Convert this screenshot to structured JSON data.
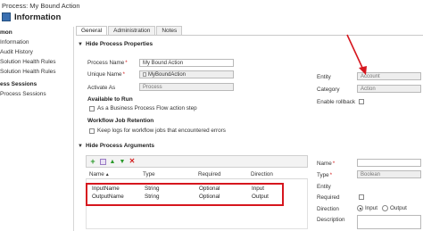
{
  "window": {
    "title": "Process: My Bound Action",
    "heading": "Information"
  },
  "sidebar": {
    "items": [
      {
        "label": "mon",
        "head": true
      },
      {
        "label": "Information",
        "head": false
      },
      {
        "label": "Audit History",
        "head": false
      },
      {
        "label": "Solution Health Rules",
        "head": false
      },
      {
        "label": "Solution Health Rules",
        "head": false
      },
      {
        "label": "ess Sessions",
        "head": true
      },
      {
        "label": "Process Sessions",
        "head": false
      }
    ]
  },
  "tabs": [
    {
      "label": "General",
      "active": true
    },
    {
      "label": "Administration",
      "active": false
    },
    {
      "label": "Notes",
      "active": false
    }
  ],
  "properties": {
    "section_label": "Hide Process Properties",
    "process_name_label": "Process Name",
    "process_name_value": "My Bound Action",
    "unique_name_label": "Unique Name",
    "unique_name_value": "MyBoundAction",
    "activate_as_label": "Activate As",
    "activate_as_value": "Process",
    "available_to_run_label": "Available to Run",
    "bpf_step_label": "As a Business Process Flow action step",
    "retention_label": "Workflow Job Retention",
    "keep_logs_label": "Keep logs for workflow jobs that encountered errors"
  },
  "right_props": {
    "entity_label": "Entity",
    "entity_value": "Account",
    "category_label": "Category",
    "category_value": "Action",
    "rollback_label": "Enable rollback"
  },
  "arguments": {
    "section_label": "Hide Process Arguments",
    "columns": [
      "Name",
      "Type",
      "Required",
      "Direction"
    ],
    "rows": [
      {
        "name": "InputName",
        "type": "String",
        "required": "Optional",
        "direction": "Input"
      },
      {
        "name": "OutputName",
        "type": "String",
        "required": "Optional",
        "direction": "Output"
      }
    ]
  },
  "arg_detail": {
    "name_label": "Name",
    "name_value": "",
    "type_label": "Type",
    "type_value": "Boolean",
    "entity_label": "Entity",
    "required_label": "Required",
    "direction_label": "Direction",
    "direction_input": "Input",
    "direction_output": "Output",
    "description_label": "Description"
  },
  "colors": {
    "annotation_red": "#d6161e",
    "required_star": "#d42222"
  },
  "icons": [
    "add-icon",
    "edit-icon",
    "move-up-icon",
    "move-down-icon",
    "delete-icon"
  ]
}
